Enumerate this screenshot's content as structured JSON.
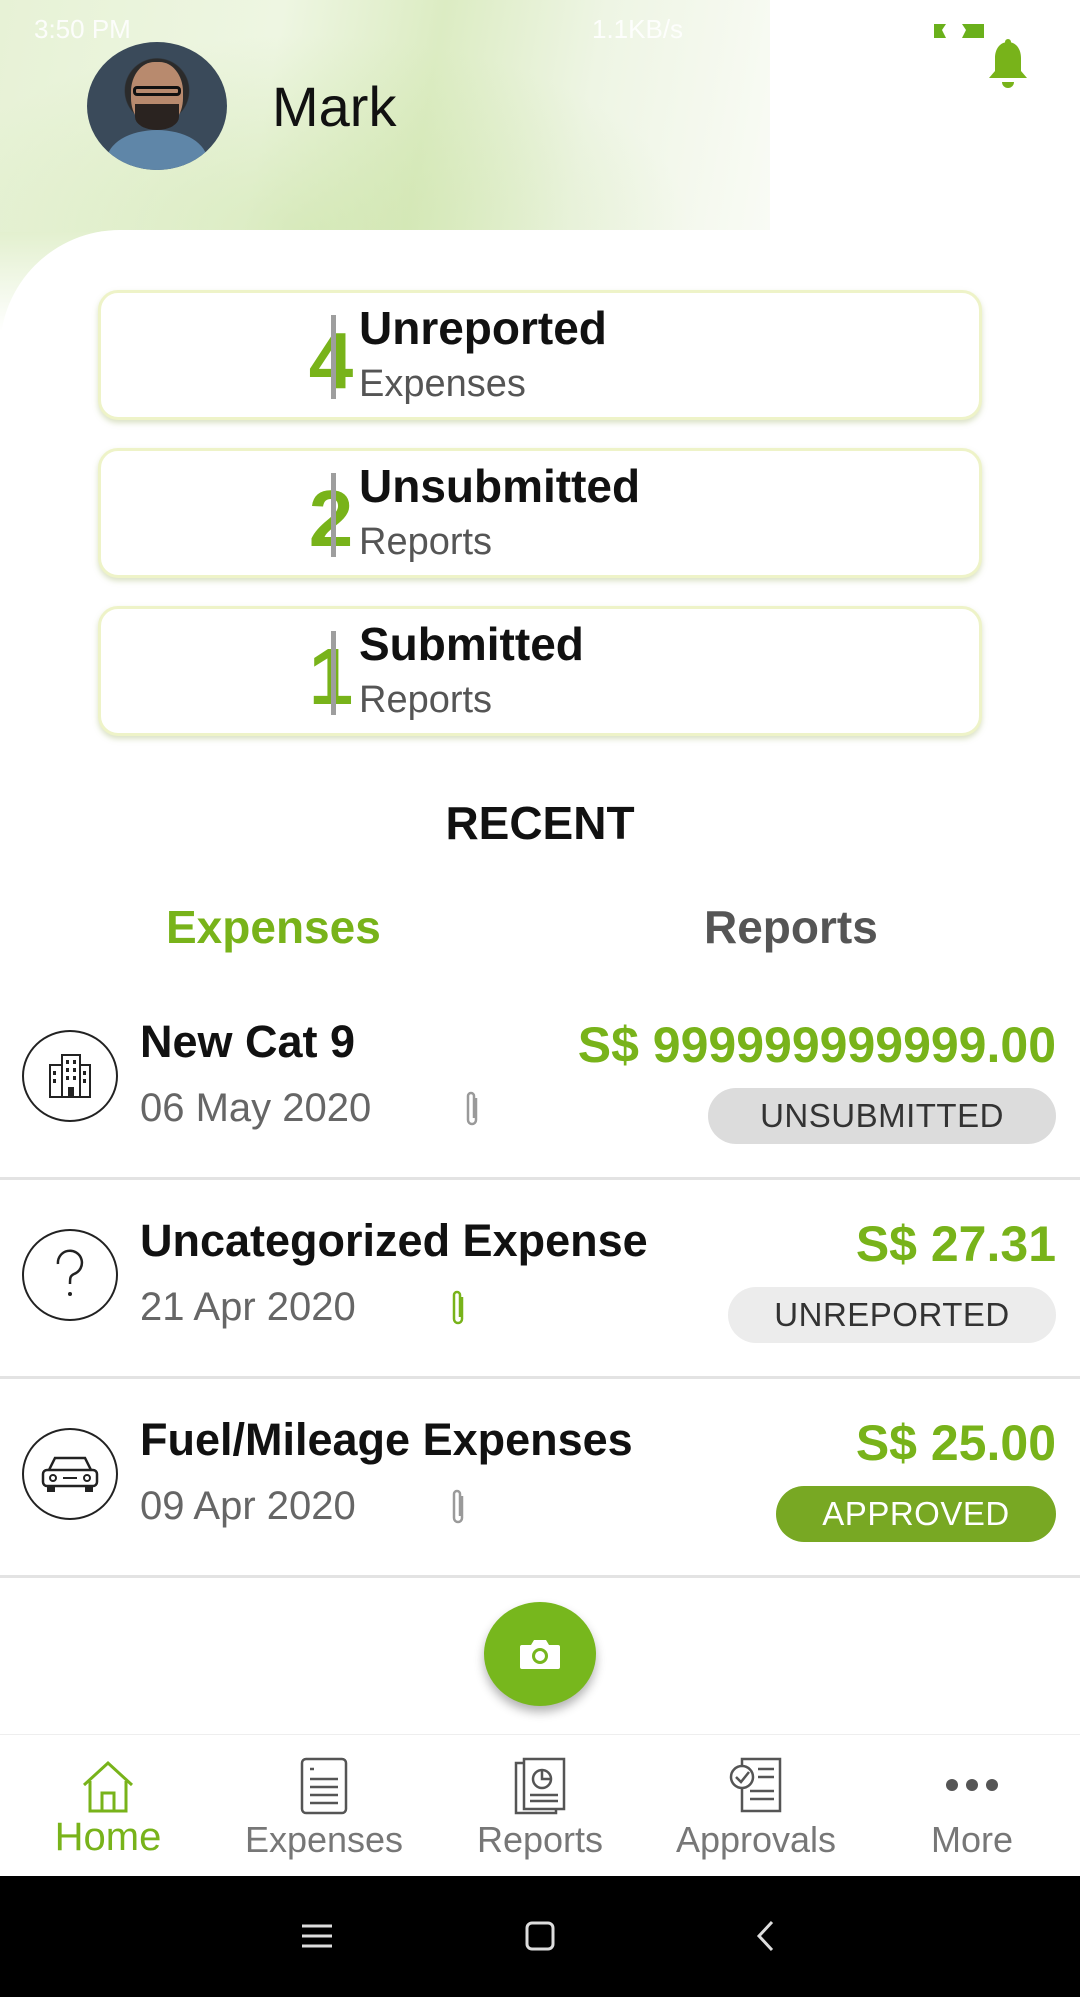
{
  "status_bar": {
    "time": "3:50 PM",
    "speed": "1.1KB/s"
  },
  "user": {
    "name": "Mark"
  },
  "summary": [
    {
      "count": "4",
      "title": "Unreported",
      "subtitle": "Expenses"
    },
    {
      "count": "2",
      "title": "Unsubmitted",
      "subtitle": "Reports"
    },
    {
      "count": "1",
      "title": "Submitted",
      "subtitle": "Reports"
    }
  ],
  "recent": {
    "title": "RECENT",
    "tabs": [
      {
        "label": "Expenses",
        "active": true
      },
      {
        "label": "Reports",
        "active": false
      }
    ]
  },
  "expenses": [
    {
      "icon": "building-icon",
      "name": "New Cat 9",
      "date": "06 May 2020",
      "amount": "S$ 999999999999.00",
      "status": "UNSUBMITTED",
      "attachment": "paperclip-icon"
    },
    {
      "icon": "question-icon",
      "name": "Uncategorized Expense",
      "date": "21 Apr 2020",
      "amount": "S$ 27.31",
      "status": "UNREPORTED",
      "attachment": "paperclip-icon"
    },
    {
      "icon": "car-icon",
      "name": "Fuel/Mileage Expenses",
      "date": "09 Apr 2020",
      "amount": "S$ 25.00",
      "status": "APPROVED",
      "attachment": "paperclip-icon"
    }
  ],
  "fab": {
    "icon": "camera-icon"
  },
  "bottom_nav": [
    {
      "label": "Home",
      "icon": "home-icon",
      "active": true
    },
    {
      "label": "Expenses",
      "icon": "expenses-icon",
      "active": false
    },
    {
      "label": "Reports",
      "icon": "reports-icon",
      "active": false
    },
    {
      "label": "Approvals",
      "icon": "approvals-icon",
      "active": false
    },
    {
      "label": "More",
      "icon": "more-icon",
      "active": false
    }
  ],
  "colors": {
    "accent": "#78b31a",
    "approved": "#78a823",
    "badge_grey": "#dcdcdc"
  }
}
